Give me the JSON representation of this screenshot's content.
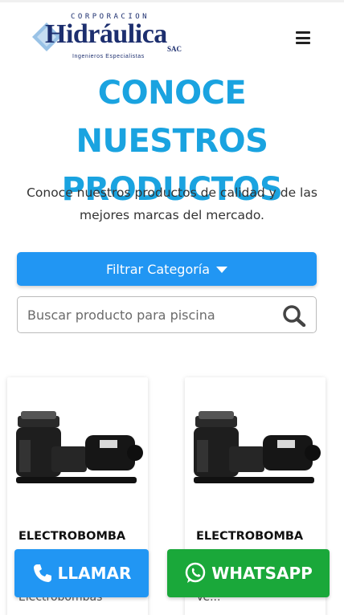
{
  "header": {
    "logo": {
      "corp": "CORPORACION",
      "main": "Hidráulica",
      "suffix": "SAC",
      "tagline": "Ingenieros Especialistas"
    },
    "menu_icon": "hamburger-icon"
  },
  "hero": {
    "title_line1": "CONOCE NUESTROS",
    "title_line2": "PRODUCTOS",
    "subtitle_line1": "Conoce nuestros productos de calidad y de las",
    "subtitle_line2": "mejores marcas del mercado."
  },
  "filter": {
    "label": "Filtrar Categoría"
  },
  "search": {
    "placeholder": "Buscar producto para piscina",
    "value": ""
  },
  "products": [
    {
      "name": "ELECTROBOMBA",
      "category": "Electrobombas"
    },
    {
      "name": "ELECTROBOMBA",
      "category": "Ve..."
    }
  ],
  "cta": {
    "call_label": "LLAMAR",
    "whatsapp_label": "WHATSAPP"
  },
  "colors": {
    "accent": "#1aa3e0",
    "button_blue": "#2196f3",
    "whatsapp_green": "#1aa83a",
    "logo_navy": "#1d2f6f"
  }
}
